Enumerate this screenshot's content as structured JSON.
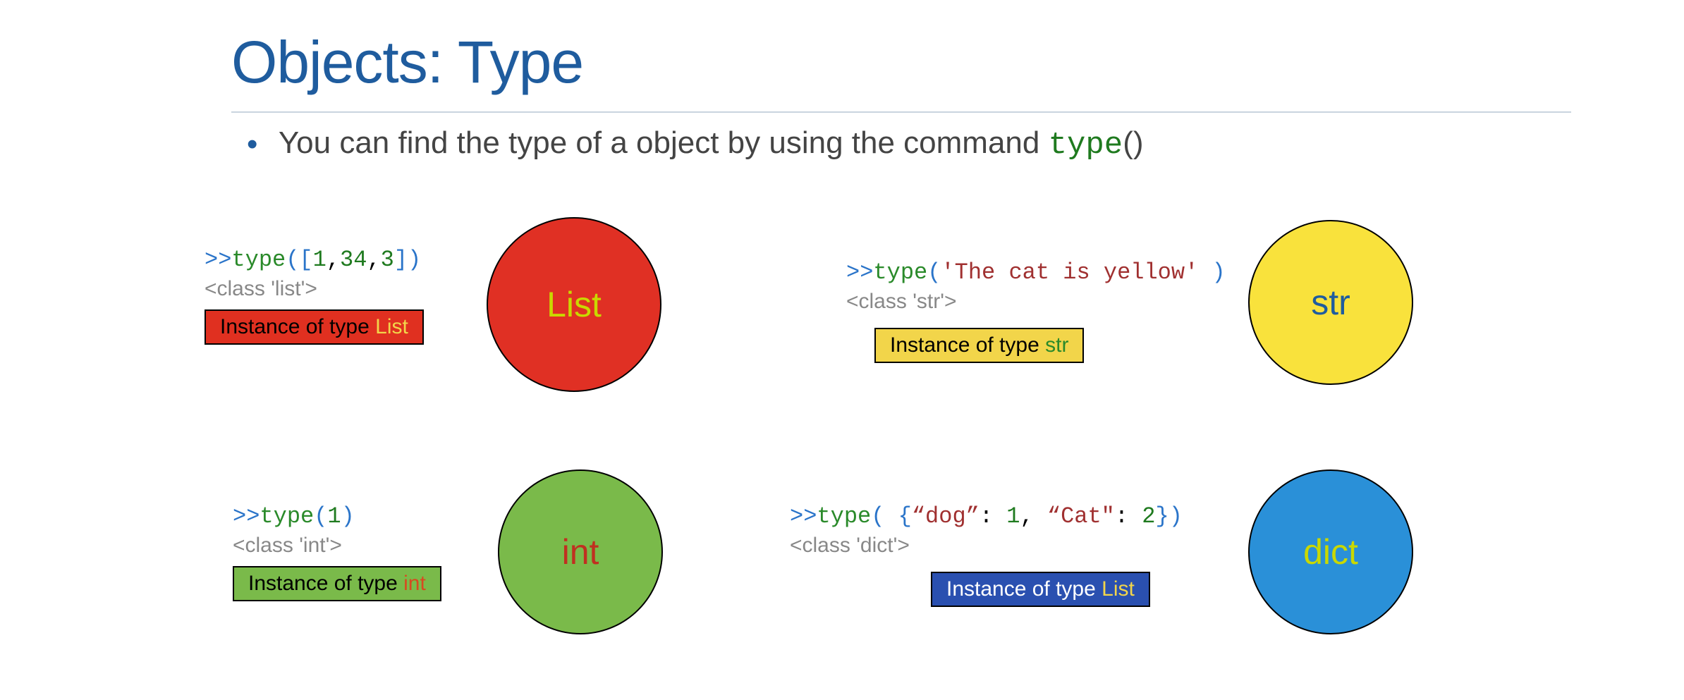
{
  "title": "Objects: Type",
  "bullet": {
    "prefix": "You can find the type of a object by using the command ",
    "code": "type",
    "suffix": "()"
  },
  "cells": {
    "list": {
      "prompt": ">>",
      "func": "type",
      "open": "([",
      "arg_a": "1",
      "comma1": ",",
      "arg_b": "34",
      "comma2": ",",
      "arg_c": "3",
      "close": "])",
      "result": "<class 'list'>",
      "instance_pre": "Instance of type ",
      "instance_hl": "List",
      "circle": "List"
    },
    "str": {
      "prompt": ">>",
      "func": "type",
      "open": "(",
      "arg": "'The cat is yellow'",
      "close": " )",
      "result": "<class 'str'>",
      "instance_pre": "Instance of type ",
      "instance_hl": "str",
      "circle": "str"
    },
    "int": {
      "prompt": ">>",
      "func": "type",
      "open": "(",
      "arg": "1",
      "close": ")",
      "result": "<class 'int'>",
      "instance_pre": "Instance of type ",
      "instance_hl": "int",
      "circle": "int"
    },
    "dict": {
      "prompt": ">>",
      "func": "type",
      "open": "( {",
      "k1": "“dog”",
      "colon1": ": ",
      "v1": "1",
      "comma": ", ",
      "k2": "“Cat\"",
      "colon2": ": ",
      "v2": "2",
      "close": "})",
      "result": "<class 'dict'>",
      "instance_pre": "Instance of type ",
      "instance_hl": "List",
      "circle": "dict"
    }
  }
}
